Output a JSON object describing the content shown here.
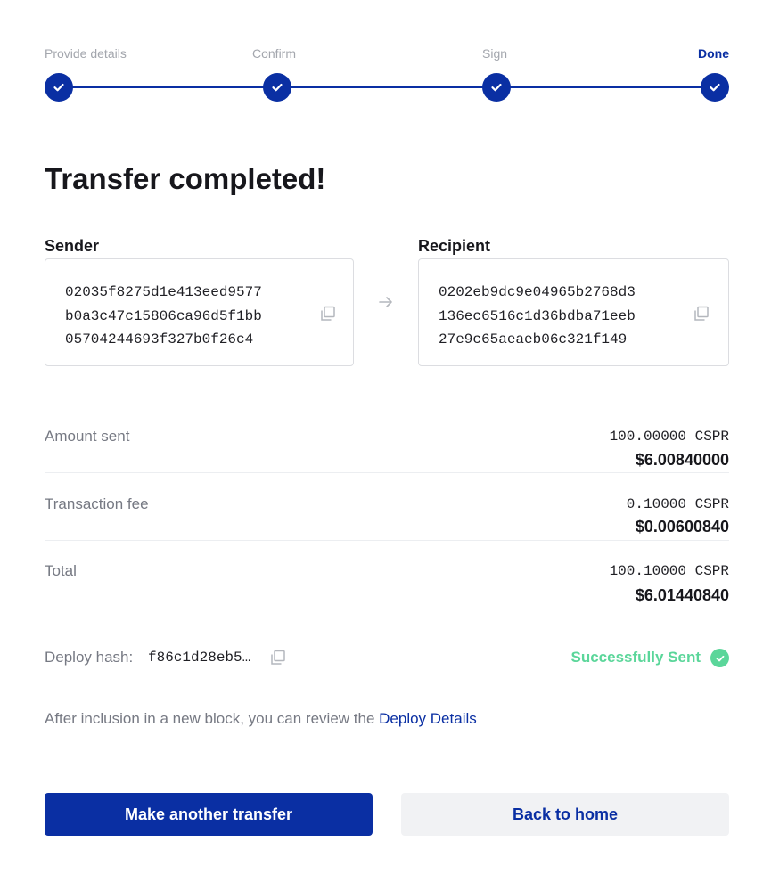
{
  "stepper": {
    "steps": [
      {
        "label": "Provide details",
        "active": false
      },
      {
        "label": "Confirm",
        "active": false
      },
      {
        "label": "Sign",
        "active": false
      },
      {
        "label": "Done",
        "active": true
      }
    ],
    "icon": "check-icon",
    "accent_color": "#0a2fa3"
  },
  "heading": "Transfer completed!",
  "sender": {
    "label": "Sender",
    "address_lines": [
      "02035f8275d1e413eed9577",
      "b0a3c47c15806ca96d5f1bb",
      "05704244693f327b0f26c4"
    ]
  },
  "recipient": {
    "label": "Recipient",
    "address_lines": [
      "0202eb9dc9e04965b2768d3",
      "136ec6516c1d36bdba71eeb",
      "27e9c65aeaeb06c321f149"
    ]
  },
  "summary": {
    "amount": {
      "label": "Amount sent",
      "cspr": "100.00000 CSPR",
      "fiat": "$6.00840000"
    },
    "fee": {
      "label": "Transaction fee",
      "cspr": "0.10000 CSPR",
      "fiat": "$0.00600840"
    },
    "total": {
      "label": "Total",
      "cspr": "100.10000 CSPR",
      "fiat": "$6.01440840"
    }
  },
  "deploy": {
    "label": "Deploy hash:",
    "hash": "f86c1d28eb5…",
    "status": "Successfully Sent",
    "status_color": "#5bd69a"
  },
  "info": {
    "text": "After inclusion in a new block, you can review the ",
    "link": "Deploy Details"
  },
  "buttons": {
    "primary": "Make another transfer",
    "secondary": "Back to home"
  }
}
